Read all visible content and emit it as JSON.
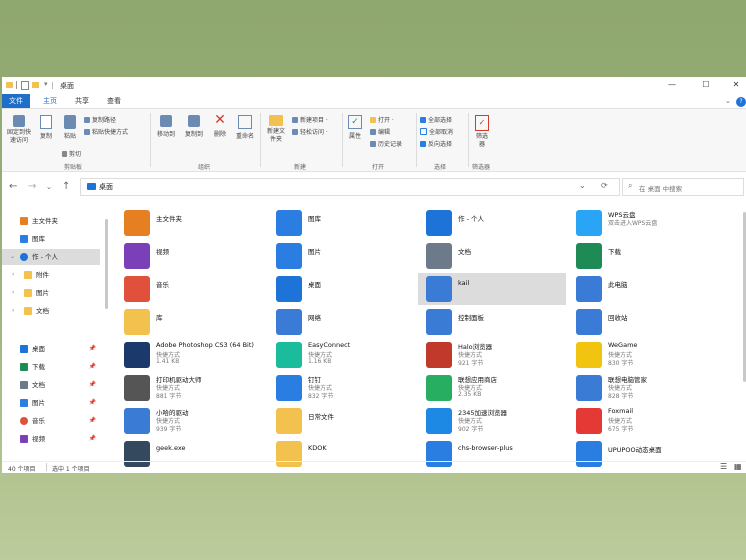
{
  "window": {
    "title": "桌面",
    "menu_tabs": [
      "文件",
      "主页",
      "共享",
      "查看"
    ],
    "controls": {
      "minimize": "—",
      "maximize": "☐",
      "close": "✕",
      "collapse": "⌄",
      "help": "?"
    }
  },
  "ribbon": {
    "clipboard": {
      "pin_label": "固定到快速访问",
      "copy_label": "复制",
      "paste_label": "粘贴",
      "copy_path": "复制路径",
      "paste_shortcut": "粘贴快捷方式",
      "cut": "剪切",
      "group": "剪贴板"
    },
    "organize": {
      "move_to": "移动到",
      "copy_to": "复制到",
      "delete": "删除",
      "rename": "重命名",
      "group": "组织"
    },
    "new": {
      "new_folder": "新建文件夹",
      "new_item": "新建项目 ·",
      "easy_access": "轻松访问 ·",
      "group": "新建"
    },
    "open": {
      "properties": "属性",
      "open": "打开 ·",
      "edit": "编辑",
      "history": "历史记录",
      "group": "打开"
    },
    "select": {
      "select_all": "全部选择",
      "select_none": "全部取消",
      "invert": "反向选择",
      "group": "选择"
    },
    "filter": {
      "label": "筛选器",
      "group": "筛选器"
    }
  },
  "address": {
    "back": "←",
    "forward": "→",
    "dropdown": "⌄",
    "up": "↑",
    "path": "桌面",
    "refresh": "⟳",
    "path_dropdown": "⌄",
    "search_placeholder": "在 桌面 中搜索"
  },
  "sidebar": {
    "items": [
      {
        "label": "主文件夹",
        "color": "#e67e22"
      },
      {
        "label": "图库",
        "color": "#2a7de1"
      },
      {
        "label": "作 - 个人",
        "color": "#1e73d8",
        "selected": true
      },
      {
        "label": "附件",
        "color": "#f2c14e"
      },
      {
        "label": "图片",
        "color": "#f2c14e"
      },
      {
        "label": "文档",
        "color": "#f2c14e"
      },
      {
        "label": "桌面",
        "color": "#1e73d8",
        "pinned": true
      },
      {
        "label": "下载",
        "color": "#1e8b57",
        "pinned": true
      },
      {
        "label": "文档",
        "color": "#6c7a89",
        "pinned": true
      },
      {
        "label": "图片",
        "color": "#2a7de1",
        "pinned": true
      },
      {
        "label": "音乐",
        "color": "#e0503a",
        "pinned": true
      },
      {
        "label": "视频",
        "color": "#7b3fb8",
        "pinned": true
      }
    ],
    "pin_glyph": "📌",
    "chev_open": "⌄",
    "chev_closed": "›"
  },
  "files": [
    {
      "name": "主文件夹",
      "color": "#e67e22"
    },
    {
      "name": "图库",
      "color": "#2a7de1"
    },
    {
      "name": "作 - 个人",
      "color": "#1e73d8"
    },
    {
      "name": "WPS云盘",
      "sub1": "双击进入WPS云盘",
      "color": "#2aa4f4"
    },
    {
      "name": "视频",
      "color": "#7b3fb8"
    },
    {
      "name": "图片",
      "color": "#2a7de1"
    },
    {
      "name": "文档",
      "color": "#6c7a89"
    },
    {
      "name": "下载",
      "color": "#1e8b57"
    },
    {
      "name": "音乐",
      "color": "#e0503a"
    },
    {
      "name": "桌面",
      "color": "#1e73d8"
    },
    {
      "name": "kail",
      "color": "#3a7bd5",
      "selected": true
    },
    {
      "name": "此电脑",
      "color": "#3a7bd5"
    },
    {
      "name": "库",
      "color": "#f2c14e"
    },
    {
      "name": "网络",
      "color": "#3a7bd5"
    },
    {
      "name": "控制面板",
      "color": "#3a7bd5"
    },
    {
      "name": "回收站",
      "color": "#3a7bd5"
    },
    {
      "name": "Adobe Photoshop CS3 (64 Bit)",
      "sub1": "快捷方式",
      "sub2": "1.41 KB",
      "color": "#1b3a6b"
    },
    {
      "name": "EasyConnect",
      "sub1": "快捷方式",
      "sub2": "1.16 KB",
      "color": "#1abc9c"
    },
    {
      "name": "Halo浏览器",
      "sub1": "快捷方式",
      "sub2": "921 字节",
      "color": "#c0392b"
    },
    {
      "name": "WeGame",
      "sub1": "快捷方式",
      "sub2": "830 字节",
      "color": "#f1c40f"
    },
    {
      "name": "打印机驱动大师",
      "sub1": "快捷方式",
      "sub2": "881 字节",
      "color": "#555555"
    },
    {
      "name": "钉钉",
      "sub1": "快捷方式",
      "sub2": "832 字节",
      "color": "#2a7de1"
    },
    {
      "name": "联想应用商店",
      "sub1": "快捷方式",
      "sub2": "2.35 KB",
      "color": "#27ae60"
    },
    {
      "name": "联想电脑管家",
      "sub1": "快捷方式",
      "sub2": "828 字节",
      "color": "#3a7bd5"
    },
    {
      "name": "小哈的驱动",
      "sub1": "快捷方式",
      "sub2": "939 字节",
      "color": "#3a7bd5"
    },
    {
      "name": "日常文件",
      "color": "#f2c14e"
    },
    {
      "name": "2345加速浏览器",
      "sub1": "快捷方式",
      "sub2": "902 字节",
      "color": "#1e88e5"
    },
    {
      "name": "Foxmail",
      "sub1": "快捷方式",
      "sub2": "675 字节",
      "color": "#e53935"
    },
    {
      "name": "geek.exe",
      "color": "#34495e"
    },
    {
      "name": "KDOK",
      "color": "#f2c14e"
    },
    {
      "name": "chs-browser-plus",
      "color": "#2a7de1"
    },
    {
      "name": "UPUPOO动态桌面",
      "color": "#2a7de1"
    }
  ],
  "status": {
    "count": "40 个项目",
    "selected": "选中 1 个项目",
    "details_icon": "☰",
    "tiles_icon": "▦"
  }
}
